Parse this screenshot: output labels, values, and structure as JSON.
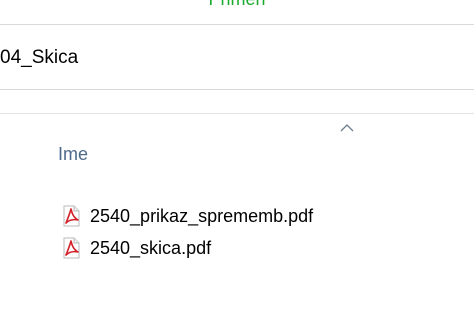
{
  "window": {
    "title": "Primeri"
  },
  "address_bar": {
    "path": "04_Skica"
  },
  "file_list": {
    "column_header": "Ime",
    "sort_direction": "ascending",
    "items": [
      {
        "name": "2540_prikaz_sprememb.pdf",
        "icon": "pdf-file-icon"
      },
      {
        "name": "2540_skica.pdf",
        "icon": "pdf-file-icon"
      }
    ]
  },
  "colors": {
    "title_accent": "#1aab2e",
    "column_header_text": "#4e6a8a",
    "pdf_icon_red": "#d4202a"
  }
}
